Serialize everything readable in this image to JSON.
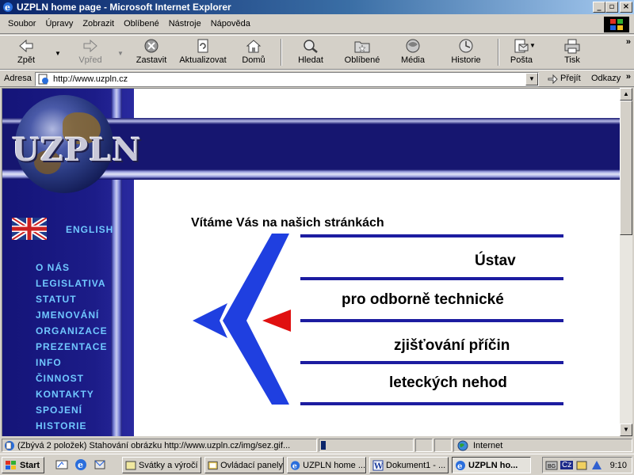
{
  "window": {
    "title": "UZPLN home page - Microsoft Internet Explorer",
    "buttons": {
      "minimize": "_",
      "maximize": "▫",
      "close": "×"
    }
  },
  "menu": [
    "Soubor",
    "Úpravy",
    "Zobrazit",
    "Oblíbené",
    "Nástroje",
    "Nápověda"
  ],
  "toolbar": {
    "back": "Zpět",
    "forward": "Vpřed",
    "stop": "Zastavit",
    "refresh": "Aktualizovat",
    "home": "Domů",
    "search": "Hledat",
    "favorites": "Oblíbené",
    "media": "Média",
    "history": "Historie",
    "mail": "Pošta",
    "print": "Tisk",
    "more": "»"
  },
  "address": {
    "label": "Adresa",
    "url": "http://www.uzpln.cz",
    "go": "Přejít",
    "links": "Odkazy",
    "more": "»"
  },
  "page": {
    "logo": "UZPLN",
    "english": "ENGLISH",
    "nav": [
      "O NÁS",
      "LEGISLATIVA",
      "STATUT",
      "JMENOVÁNÍ",
      "ORGANIZACE",
      "PREZENTACE",
      "INFO",
      "ČINNOST",
      "KONTAKTY",
      "SPOJENÍ",
      "HISTORIE"
    ],
    "welcome": "Vítáme Vás na našich stránkách",
    "slogan": [
      "Ústav",
      "pro odborně technické",
      "zjišťování příčin",
      "leteckých nehod"
    ],
    "colors": {
      "nav_bg": "#1a1a7a",
      "nav_link": "#70c8ff",
      "line": "#1c1ca0",
      "plane_blue": "#1f3fe0",
      "plane_red": "#e01010"
    }
  },
  "status": {
    "text": "(Zbývá 2 položek) Stahování obrázku http://www.uzpln.cz/img/sez.gif...",
    "zone": "Internet"
  },
  "taskbar": {
    "start": "Start",
    "tasks": [
      "Svátky a výročí",
      "Ovládací panely",
      "UZPLN home ...",
      "Dokument1 - ...",
      "UZPLN ho..."
    ],
    "lang": "Cz",
    "clock": "9:10"
  }
}
